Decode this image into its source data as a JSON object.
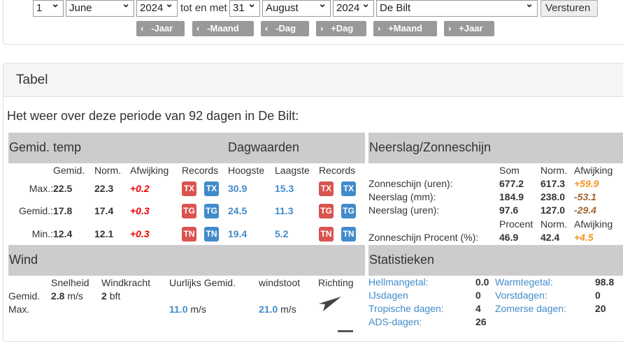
{
  "form": {
    "day_from": "1",
    "month_from": "June",
    "year_from": "2024",
    "tot_label": "tot en met",
    "day_to": "31",
    "month_to": "August",
    "year_to": "2024",
    "station": "De Bilt",
    "submit": "Versturen"
  },
  "nav": [
    "-Jaar",
    "-Maand",
    "-Dag",
    "+Dag",
    "+Maand",
    "+Jaar"
  ],
  "panel_title": "Tabel",
  "heading": "Het weer over deze periode van 92 dagen in De Bilt:",
  "temp": {
    "title": "Gemid. temp",
    "day_title": "Dagwaarden",
    "headers": [
      "Gemid.",
      "Norm.",
      "Afwijking",
      "Records",
      "Hoogste",
      "Laagste",
      "Records"
    ],
    "rows": [
      {
        "label": "Max.:",
        "avg": "22.5",
        "norm": "22.3",
        "dev": "+0.2",
        "badge": "TX",
        "high": "30.9",
        "low": "15.3"
      },
      {
        "label": "Gemid.:",
        "avg": "17.8",
        "norm": "17.4",
        "dev": "+0.3",
        "badge": "TG",
        "high": "24.5",
        "low": "11.3"
      },
      {
        "label": "Min.:",
        "avg": "12.4",
        "norm": "12.1",
        "dev": "+0.3",
        "badge": "TN",
        "high": "19.4",
        "low": "5.2"
      }
    ]
  },
  "neerslag": {
    "title": "Neerslag/Zonneschijn",
    "headers": [
      "Som",
      "Norm.",
      "Afwijking"
    ],
    "rows": [
      {
        "label": "Zonneschijn (uren):",
        "val": "677.2",
        "norm": "617.3",
        "dev": "+59.9"
      },
      {
        "label": "Neerslag (mm):",
        "val": "184.9",
        "norm": "238.0",
        "dev": "-53.1"
      },
      {
        "label": "Neerslag (uren):",
        "val": "97.6",
        "norm": "127.0",
        "dev": "-29.4"
      }
    ],
    "headers2": [
      "Procent",
      "Norm.",
      "Afwijking"
    ],
    "pct": {
      "label": "Zonneschijn Procent (%):",
      "val": "46.9",
      "norm": "42.4",
      "dev": "+4.5"
    }
  },
  "wind": {
    "title": "Wind",
    "headers": [
      "Snelheid",
      "Windkracht",
      "Uurlijks Gemid.",
      "windstoot",
      "Richting"
    ],
    "gemid_label": "Gemid.",
    "max_label": "Max.",
    "speed": "2.8",
    "speed_unit": "m/s",
    "force": "2",
    "force_unit": "bft",
    "hourly": "11.0",
    "hourly_unit": "m/s",
    "gust": "21.0",
    "gust_unit": "m/s"
  },
  "stats": {
    "title": "Statistieken",
    "items": [
      {
        "label": "Hellmangetal:",
        "value": "0.0"
      },
      {
        "label": "Warmtegetal:",
        "value": "98.8"
      },
      {
        "label": "IJsdagen",
        "value": "0"
      },
      {
        "label": "Vorstdagen:",
        "value": "0"
      },
      {
        "label": "Tropische dagen:",
        "value": "4"
      },
      {
        "label": "Zomerse dagen:",
        "value": "20"
      },
      {
        "label": "ADS-dagen:",
        "value": "26"
      }
    ]
  }
}
